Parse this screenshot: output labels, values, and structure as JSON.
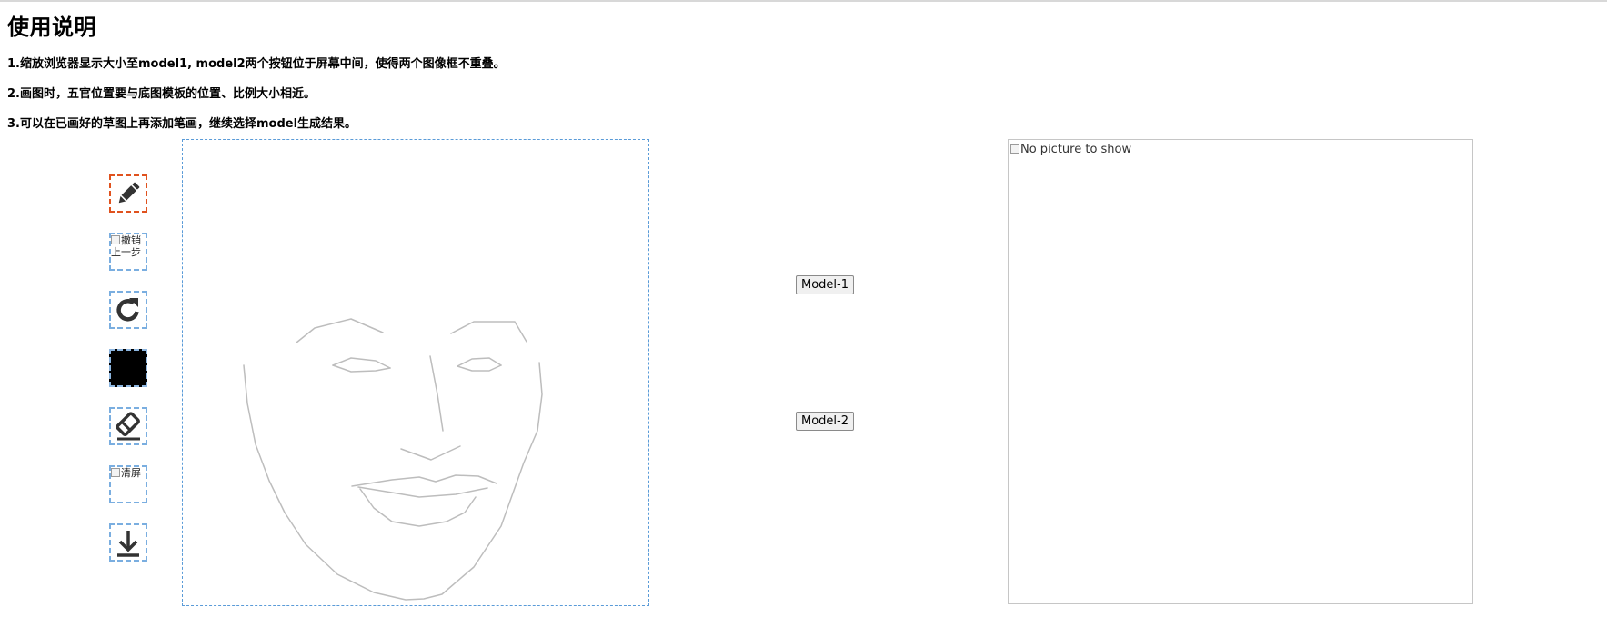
{
  "instructions": {
    "title": "使用说明",
    "items": [
      "1.缩放浏览器显示大小至model1, model2两个按钮位于屏幕中间，使得两个图像框不重叠。",
      "2.画图时，五官位置要与底图模板的位置、比例大小相近。",
      "3.可以在已画好的草图上再添加笔画，继续选择model生成结果。"
    ]
  },
  "toolbar": {
    "tools": [
      {
        "name": "pencil-icon",
        "state": "selected"
      },
      {
        "name": "undo-image",
        "alt": "撤销上一步"
      },
      {
        "name": "redo-icon"
      },
      {
        "name": "color-swatch",
        "color": "#000000"
      },
      {
        "name": "eraser-icon"
      },
      {
        "name": "clear-image",
        "alt": "清屏"
      },
      {
        "name": "download-icon"
      }
    ]
  },
  "models": {
    "model1_label": "Model-1",
    "model2_label": "Model-2"
  },
  "result": {
    "alt": "No picture to show"
  },
  "colors": {
    "canvas_border": "#5a9bd8",
    "tool_border": "#7aaee0",
    "active_tool_border": "#e0521e",
    "sketch_stroke": "#bdbdbd"
  }
}
